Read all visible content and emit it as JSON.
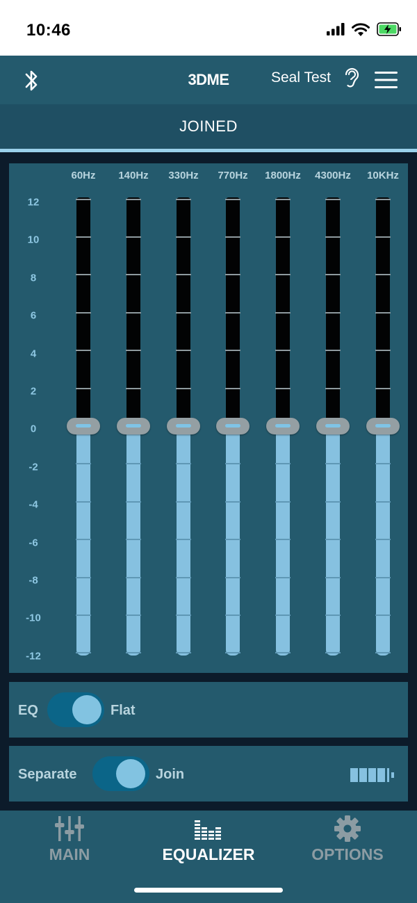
{
  "status_bar": {
    "time": "10:46"
  },
  "header": {
    "title": "3DME",
    "seal_test_label": "Seal Test"
  },
  "mode": {
    "label": "JOINED"
  },
  "equalizer": {
    "frequencies": [
      "60Hz",
      "140Hz",
      "330Hz",
      "770Hz",
      "1800Hz",
      "4300Hz",
      "10KHz"
    ],
    "scale": [
      "12",
      "10",
      "8",
      "6",
      "4",
      "2",
      "0",
      "-2",
      "-4",
      "-6",
      "-8",
      "-10",
      "-12"
    ],
    "range": [
      -12,
      12
    ],
    "gains_db": [
      0,
      0,
      0,
      0,
      0,
      0,
      0
    ],
    "colors": {
      "track_upper": "#020304",
      "track_lower": "#86c1e0",
      "thumb": "#949fa3"
    }
  },
  "eq_toggle": {
    "left_label": "EQ",
    "right_label": "Flat"
  },
  "join_toggle": {
    "left_label": "Separate",
    "right_label": "Join"
  },
  "tabs": [
    {
      "label": "MAIN",
      "icon": "sliders-icon",
      "active": false
    },
    {
      "label": "EQUALIZER",
      "icon": "equalizer-bars-icon",
      "active": true
    },
    {
      "label": "OPTIONS",
      "icon": "gear-icon",
      "active": false
    }
  ],
  "colors": {
    "accent": "#245a6d",
    "highlight": "#9ad0ea",
    "switch": "#0b6588"
  }
}
